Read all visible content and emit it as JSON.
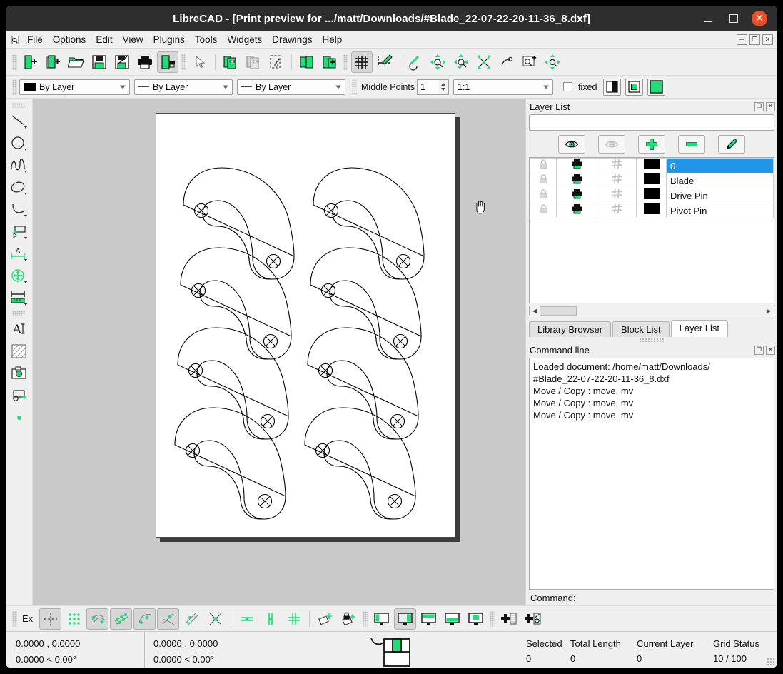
{
  "window": {
    "title": "LibreCAD - [Print preview for .../matt/Downloads/#Blade_22-07-22-20-11-36_8.dxf]",
    "minimize_label": "",
    "maximize_label": "",
    "close_label": "✕"
  },
  "menubar": {
    "app_icon": "magnifier-document-icon",
    "items": [
      {
        "label": "File",
        "pre": "",
        "key": "F",
        "post": "ile"
      },
      {
        "label": "Options",
        "pre": "",
        "key": "O",
        "post": "ptions"
      },
      {
        "label": "Edit",
        "pre": "",
        "key": "E",
        "post": "dit"
      },
      {
        "label": "View",
        "pre": "",
        "key": "V",
        "post": "iew"
      },
      {
        "label": "Plugins",
        "pre": "Pl",
        "key": "u",
        "post": "gins"
      },
      {
        "label": "Tools",
        "pre": "",
        "key": "T",
        "post": "ools"
      },
      {
        "label": "Widgets",
        "pre": "",
        "key": "W",
        "post": "idgets"
      },
      {
        "label": "Drawings",
        "pre": "",
        "key": "D",
        "post": "rawings"
      },
      {
        "label": "Help",
        "pre": "",
        "key": "H",
        "post": "elp"
      }
    ],
    "mdi_buttons": [
      "minimize-child",
      "restore-child",
      "close-child"
    ]
  },
  "main_toolbar": {
    "buttons": [
      {
        "name": "new-file-icon",
        "active": false
      },
      {
        "name": "new-from-template-icon",
        "active": false
      },
      {
        "name": "open-file-icon",
        "active": false
      },
      {
        "name": "save-icon",
        "active": false
      },
      {
        "name": "save-as-icon",
        "active": false
      },
      {
        "name": "print-icon",
        "active": false
      },
      {
        "name": "print-preview-icon",
        "active": true
      },
      {
        "name": "select-pointer-icon",
        "active": false
      },
      {
        "name": "copy-icon",
        "active": false
      },
      {
        "name": "paste-icon",
        "active": false
      },
      {
        "name": "cut-icon",
        "active": false
      },
      {
        "name": "undo-icon",
        "active": false
      },
      {
        "name": "redo-icon",
        "active": false
      },
      {
        "name": "grid-toggle-icon",
        "active": true
      },
      {
        "name": "draft-mode-icon",
        "active": false
      },
      {
        "name": "zoom-previous-icon",
        "active": false
      },
      {
        "name": "zoom-auto-icon",
        "active": false
      },
      {
        "name": "zoom-window-icon",
        "active": false
      },
      {
        "name": "zoom-pan-icon",
        "active": false
      },
      {
        "name": "zoom-redraw-icon",
        "active": false
      },
      {
        "name": "zoom-in-icon",
        "active": false
      },
      {
        "name": "zoom-panning-icon",
        "active": false
      }
    ]
  },
  "options_toolbar": {
    "color_combo": {
      "value": "By Layer",
      "icon": "color-swatch"
    },
    "linetype_combo": {
      "value": "By Layer",
      "icon": "line-dash"
    },
    "linewidth_combo": {
      "value": "By Layer",
      "icon": "line-dash"
    },
    "middle_points_label": "Middle Points",
    "middle_points_value": "1",
    "scale_combo_value": "1:1",
    "fixed_label": "fixed",
    "fixed_checked": false,
    "view_buttons": [
      "half-tone-icon",
      "draft-frame-icon",
      "full-color-icon"
    ]
  },
  "left_toolbar": {
    "tools": [
      "line-tool-icon",
      "circle-tool-icon",
      "spline-tool-icon",
      "ellipse-tool-icon",
      "arc-tool-icon",
      "polyline-tool-icon",
      "dimension-tool-icon",
      "modify-tool-icon",
      "measure-tool-icon",
      "text-tool-icon",
      "hatch-tool-icon",
      "image-tool-icon",
      "block-tool-icon",
      "point-tool-icon"
    ]
  },
  "canvas": {
    "paper_label": "print-preview-page",
    "cursor": "hand-cursor",
    "drawing": {
      "name": "blade-parts-nest",
      "rows": 4,
      "cols": 2,
      "shape": "curved-blade-with-two-pin-holes",
      "part_count": 8
    }
  },
  "layer_panel": {
    "title": "Layer List",
    "float_button": "float-icon",
    "close_button": "close-icon",
    "filter_value": "",
    "filter_placeholder": "",
    "toolbar_buttons": [
      {
        "name": "show-all-layers-button",
        "icon": "eye-open-icon",
        "enabled": true
      },
      {
        "name": "hide-all-layers-button",
        "icon": "eye-closed-icon",
        "enabled": false
      },
      {
        "name": "add-layer-button",
        "icon": "plus-icon",
        "enabled": true
      },
      {
        "name": "remove-layer-button",
        "icon": "minus-icon",
        "enabled": true
      },
      {
        "name": "edit-layer-button",
        "icon": "pencil-icon",
        "enabled": true
      }
    ],
    "columns": [
      "lock",
      "print",
      "construction",
      "color",
      "name"
    ],
    "rows": [
      {
        "name": "0",
        "selected": true,
        "color": "#000000"
      },
      {
        "name": "Blade",
        "selected": false,
        "color": "#000000"
      },
      {
        "name": "Drive Pin",
        "selected": false,
        "color": "#000000"
      },
      {
        "name": "Pivot Pin",
        "selected": false,
        "color": "#000000"
      }
    ]
  },
  "dock_tabs": [
    {
      "label": "Library Browser",
      "active": false
    },
    {
      "label": "Block List",
      "active": false
    },
    {
      "label": "Layer List",
      "active": true
    }
  ],
  "command_panel": {
    "title": "Command line",
    "float_button": "float-icon",
    "close_button": "close-icon",
    "history": [
      "Loaded document: /home/matt/Downloads/",
      "#Blade_22-07-22-20-11-36_8.dxf",
      "Move / Copy : move, mv",
      "Move / Copy : move, mv",
      "Move / Copy : move, mv"
    ],
    "prompt_label": "Command:",
    "prompt_value": ""
  },
  "bottom_toolbar": {
    "ex_label": "Ex",
    "buttons": [
      {
        "name": "snap-free-icon",
        "active": true
      },
      {
        "name": "snap-grid-icon",
        "active": false
      },
      {
        "name": "snap-endpoint-icon",
        "active": true
      },
      {
        "name": "snap-on-entity-icon",
        "active": true
      },
      {
        "name": "snap-center-icon",
        "active": true
      },
      {
        "name": "snap-middle-icon",
        "active": true
      },
      {
        "name": "snap-distance-icon",
        "active": false
      },
      {
        "name": "snap-intersection-icon",
        "active": false
      },
      {
        "name": "restrict-horizontal-icon",
        "active": false
      },
      {
        "name": "restrict-vertical-icon",
        "active": false
      },
      {
        "name": "restrict-orthogonal-icon",
        "active": false
      },
      {
        "name": "relative-zero-icon",
        "active": false
      },
      {
        "name": "lock-relative-zero-icon",
        "active": false
      },
      {
        "name": "view-draft-icon",
        "active": false
      },
      {
        "name": "view-fullscreen-icon",
        "active": true
      },
      {
        "name": "view-top-icon",
        "active": false
      },
      {
        "name": "view-bottom-icon",
        "active": false
      },
      {
        "name": "view-center-icon",
        "active": false
      },
      {
        "name": "add-layer-list-icon",
        "active": false
      },
      {
        "name": "add-tool-icon",
        "active": false
      }
    ]
  },
  "status_bar": {
    "absolute_coord": "0.0000 , 0.0000",
    "absolute_polar": "0.0000 < 0.00°",
    "relative_coord": "0.0000 , 0.0000",
    "relative_polar": "0.0000 < 0.00°",
    "mouse_icon": "mouse-widget-icon",
    "fields": [
      {
        "header": "Selected",
        "value": "0"
      },
      {
        "header": "Total Length",
        "value": "0"
      },
      {
        "header": "Current Layer",
        "value": "0"
      },
      {
        "header": "Grid Status",
        "value": "10 / 100"
      }
    ]
  },
  "colors": {
    "accent_green": "#22dd77",
    "selection_blue": "#2196e8",
    "titlebar": "#2e2e2e",
    "close_red": "#e8502a",
    "canvas_bg": "#c9c9c9",
    "chrome": "#efefef"
  }
}
